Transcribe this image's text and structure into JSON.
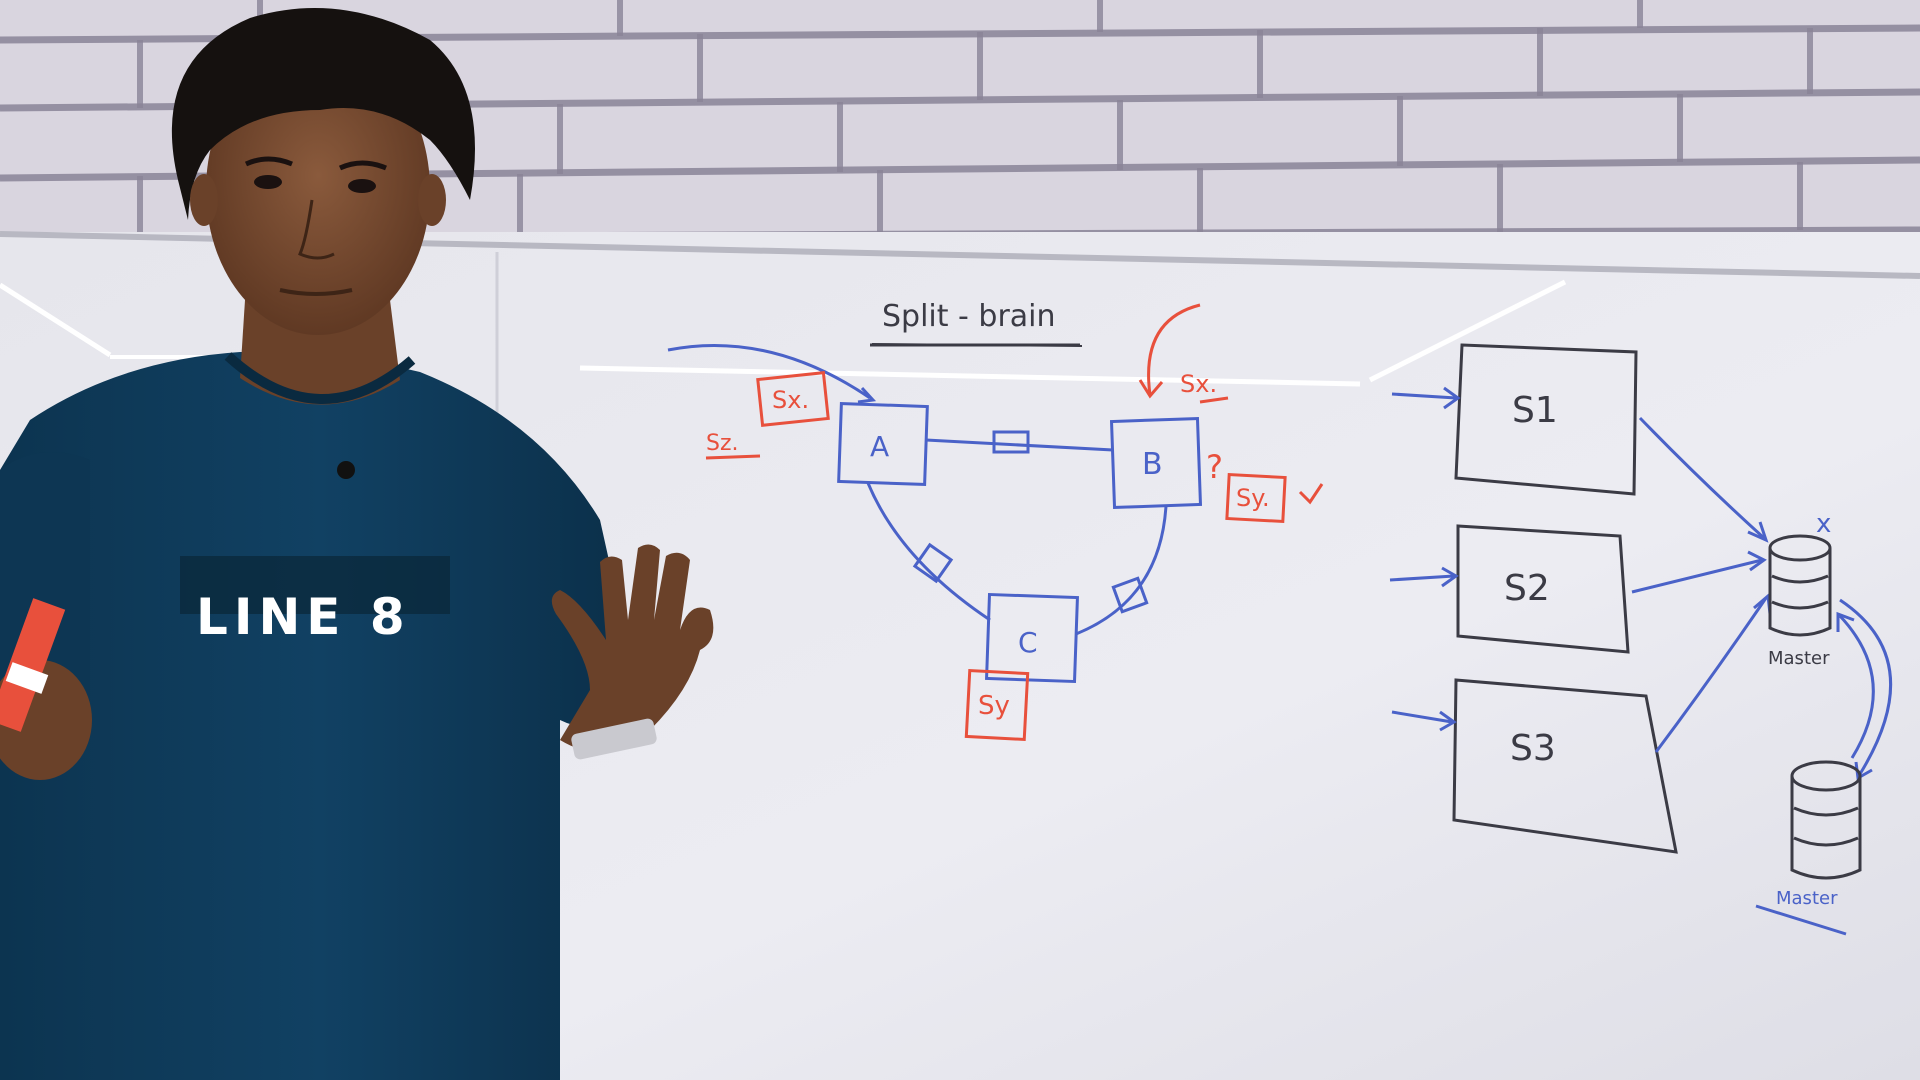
{
  "whiteboard": {
    "title": "Split - brain",
    "nodes": {
      "a": "A",
      "b": "B",
      "c": "C"
    },
    "red_labels": {
      "sx_left": "Sx.",
      "sz": "Sz.",
      "sx_right": "Sx.",
      "sy_c": "Sy",
      "sy_right": "Sy.",
      "question": "?"
    },
    "servers": {
      "s1": "S1",
      "s2": "S2",
      "s3": "S3"
    },
    "db_labels": {
      "master_top": "Master",
      "master_bottom": "Master"
    }
  },
  "shirt": {
    "text": "LINE 8"
  },
  "colors": {
    "marker_blue": "#4a62c8",
    "marker_red": "#e8503c",
    "marker_black": "#3b3b45",
    "shirt": "#0f3a55",
    "brick": "#d8d4de",
    "board": "#e9e9ef"
  }
}
